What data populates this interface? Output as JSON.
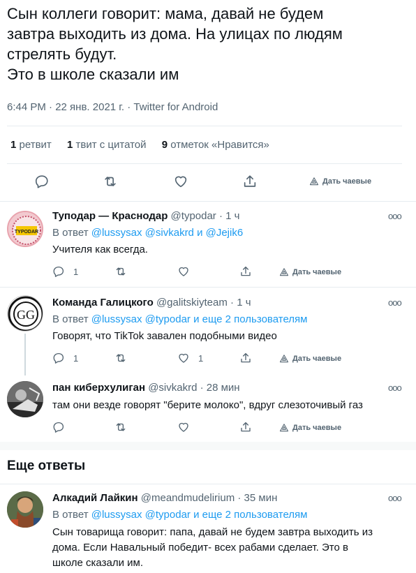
{
  "tweet": {
    "lines": [
      "Сын коллеги говорит: мама, давай не будем",
      "завтра выходить из дома. На улицах по людям",
      "стрелять будут.",
      "Это в школе сказали им"
    ],
    "meta": "6:44 PM · 22 янв. 2021 г. · Twitter for Android",
    "stats": {
      "retweets_count": "1",
      "retweets_label": "ретвит",
      "quotes_count": "1",
      "quotes_label": "твит с цитатой",
      "likes_count": "9",
      "likes_label": "отметок «Нравится»"
    },
    "tips_label": "Дать чаевые"
  },
  "replies": [
    {
      "name": "Туподар — Краснодар",
      "handle": "@typodar · 1 ч",
      "in_reply_prefix": "В ответ",
      "in_reply_links": "@lussysax @sivkakrd и @Jejik6",
      "text": [
        "Учителя как всегда."
      ],
      "reply_count": "1",
      "retweet_count": "",
      "like_count": "",
      "tips_label": "Дать чаевые",
      "avatar_text": "TYPODAR"
    },
    {
      "name": "Команда Галицкого",
      "handle": "@galitskiyteam · 1 ч",
      "in_reply_prefix": "В ответ",
      "in_reply_links": "@lussysax @typodar  и еще 2 пользователям",
      "text": [
        "Говорят, что TikTok завален подобными видео"
      ],
      "reply_count": "1",
      "retweet_count": "",
      "like_count": "1",
      "tips_label": "Дать чаевые",
      "avatar_text": "GG"
    },
    {
      "name": "пан киберхулиган",
      "handle": "@sivkakrd · 28 мин",
      "text": [
        "там они везде говорят \"берите молоко\", вдруг слезоточивый газ"
      ],
      "reply_count": "",
      "retweet_count": "",
      "like_count": "",
      "tips_label": "Дать чаевые"
    }
  ],
  "more_replies_title": "Еще ответы",
  "more_reply": {
    "name": "Алкадий Лайкин",
    "handle": "@meandmudelirium · 35 мин",
    "in_reply_prefix": "В ответ",
    "in_reply_links": "@lussysax @typodar  и еще 2 пользователям",
    "text": [
      "Сын товарища говорит: папа, давай не будем завтра выходить из",
      "дома. Если Навальный победит- всех рабами сделает. Это в",
      "школе сказали им."
    ]
  },
  "icons": [
    "reply-icon",
    "retweet-icon",
    "like-icon",
    "share-icon",
    "tips-icon",
    "more-icon"
  ],
  "colors": {
    "link": "#1d9bf0",
    "secondary": "#536471",
    "divider": "#e6ecf0",
    "text": "#0f1419"
  }
}
